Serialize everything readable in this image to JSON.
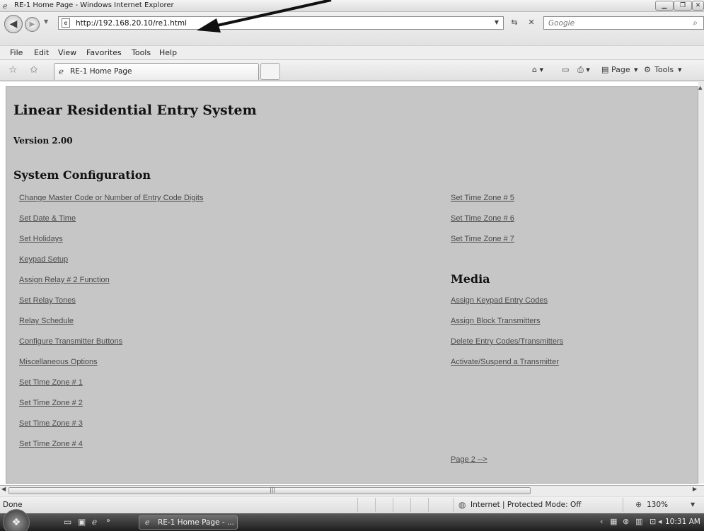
{
  "window": {
    "title": "RE-1 Home Page - Windows Internet Explorer"
  },
  "address_bar": {
    "url": "http://192.168.20.10/re1.html",
    "search_placeholder": "Google"
  },
  "menu": [
    "File",
    "Edit",
    "View",
    "Favorites",
    "Tools",
    "Help"
  ],
  "tab": {
    "label": "RE-1 Home Page"
  },
  "toolbar_right": {
    "page_label": "Page",
    "tools_label": "Tools"
  },
  "page": {
    "title": "Linear Residential Entry System",
    "version": "Version 2.00",
    "system_config_heading": "System Configuration",
    "left_links": [
      "Change Master Code or Number of Entry Code Digits",
      "Set Date & Time",
      "Set Holidays",
      "Keypad Setup",
      "Assign Relay # 2 Function",
      "Set Relay Tones",
      "Relay Schedule",
      "Configure Transmitter Buttons",
      "Miscellaneous Options",
      "Set Time Zone # 1",
      "Set Time Zone # 2",
      "Set Time Zone # 3",
      "Set Time Zone # 4"
    ],
    "right_links": [
      "Set Time Zone # 5",
      "Set Time Zone # 6",
      "Set Time Zone # 7"
    ],
    "media_heading": "Media",
    "media_links": [
      "Assign Keypad Entry Codes",
      "Assign Block Transmitters",
      "Delete Entry Codes/Transmitters",
      "Activate/Suspend a Transmitter"
    ],
    "next_page": "Page 2 -->"
  },
  "status_bar": {
    "status": "Done",
    "zone": "Internet | Protected Mode: Off",
    "zoom": "130%"
  },
  "taskbar": {
    "task_label": "RE-1 Home Page - ...",
    "clock": "10:31 AM"
  }
}
